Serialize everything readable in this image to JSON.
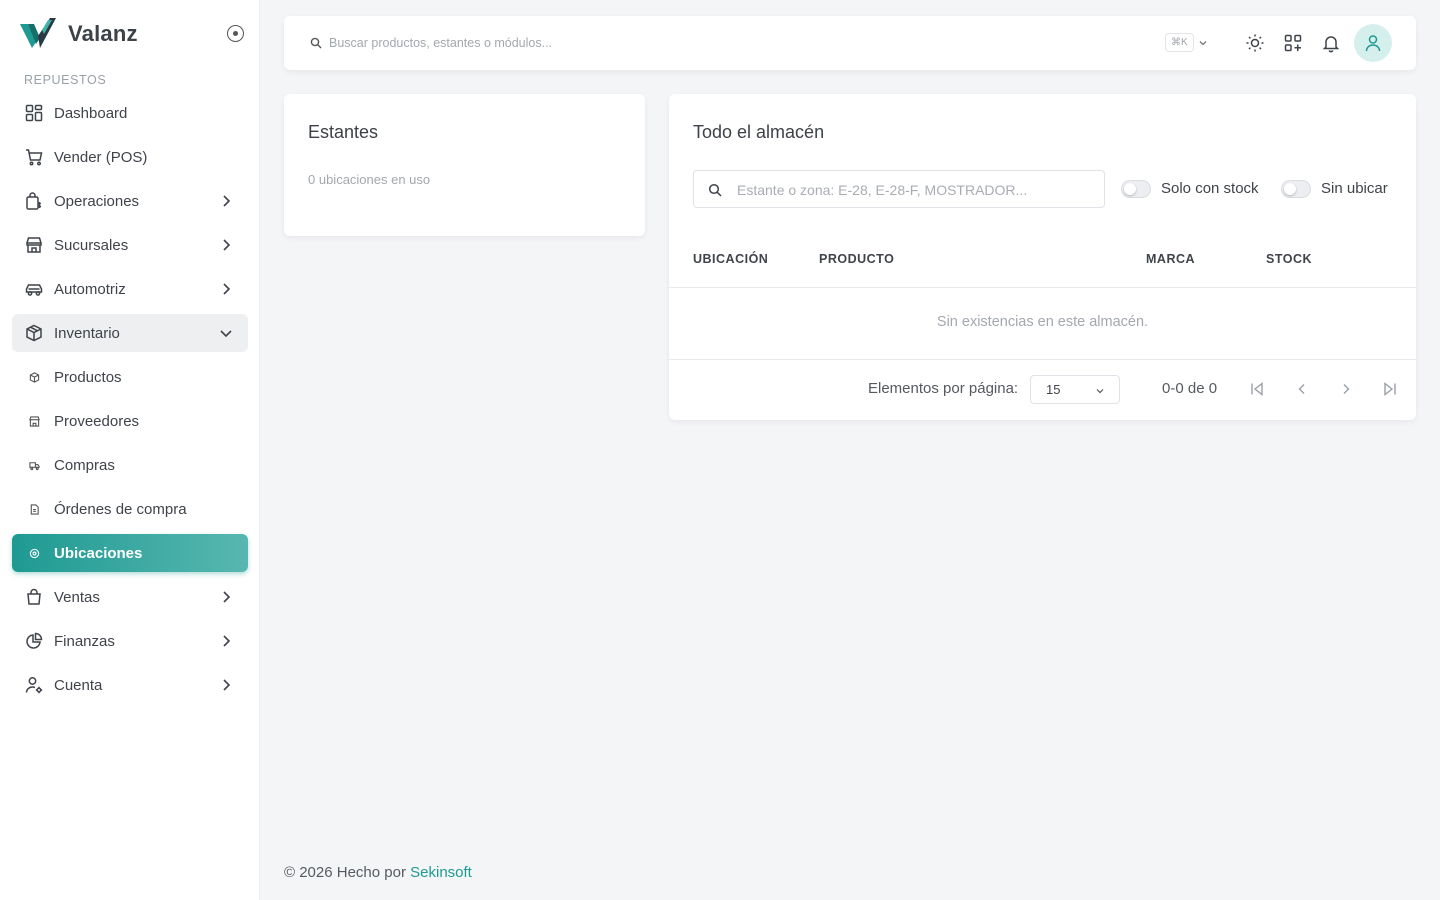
{
  "brand": {
    "name": "Valanz",
    "accent": "#1e9a92"
  },
  "sidebar": {
    "section_label": "REPUESTOS",
    "items": [
      {
        "label": "Dashboard",
        "icon": "dashboard-icon"
      },
      {
        "label": "Vender (POS)",
        "icon": "cart-icon"
      },
      {
        "label": "Operaciones",
        "icon": "operations-icon",
        "has_children": true
      },
      {
        "label": "Sucursales",
        "icon": "store-icon",
        "has_children": true
      },
      {
        "label": "Automotriz",
        "icon": "car-icon",
        "has_children": true
      },
      {
        "label": "Inventario",
        "icon": "box-icon",
        "has_children": true,
        "expanded": true
      },
      {
        "label": "Productos",
        "icon": "product-icon",
        "sub": true
      },
      {
        "label": "Proveedores",
        "icon": "supplier-icon",
        "sub": true
      },
      {
        "label": "Compras",
        "icon": "truck-icon",
        "sub": true
      },
      {
        "label": "Órdenes de compra",
        "icon": "document-icon",
        "sub": true
      },
      {
        "label": "Ubicaciones",
        "icon": "location-icon",
        "sub": true,
        "active": true
      },
      {
        "label": "Ventas",
        "icon": "shopping-bag-icon",
        "has_children": true
      },
      {
        "label": "Finanzas",
        "icon": "pie-chart-icon",
        "has_children": true
      },
      {
        "label": "Cuenta",
        "icon": "user-settings-icon",
        "has_children": true
      }
    ]
  },
  "topbar": {
    "search_placeholder": "Buscar productos, estantes o módulos...",
    "shortcut": "⌘K"
  },
  "shelves_card": {
    "title": "Estantes",
    "subtitle": "0 ubicaciones en uso"
  },
  "warehouse_card": {
    "title": "Todo el almacén",
    "search_placeholder": "Estante o zona: E-28, E-28-F, MOSTRADOR...",
    "toggle_stock_label": "Solo con stock",
    "toggle_unplaced_label": "Sin ubicar",
    "columns": [
      "UBICACIÓN",
      "PRODUCTO",
      "MARCA",
      "STOCK"
    ],
    "empty_message": "Sin existencias en este almacén.",
    "pagination": {
      "per_page_label": "Elementos por página:",
      "per_page_value": "15",
      "range": "0-0 de 0"
    }
  },
  "footer": {
    "prefix": "© 2026 Hecho por",
    "link": "Sekinsoft"
  }
}
